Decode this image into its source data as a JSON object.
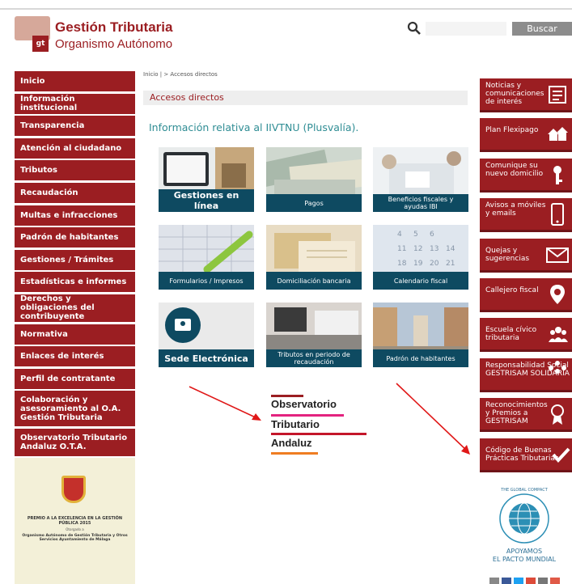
{
  "header": {
    "logo_title": "Gestión Tributaria",
    "logo_subtitle": "Organismo Autónomo",
    "logo_mark": "gt",
    "search_placeholder": "",
    "search_button": "Buscar"
  },
  "sidebar": {
    "items": [
      {
        "label": "Inicio"
      },
      {
        "label": "Información institucional"
      },
      {
        "label": "Transparencia"
      },
      {
        "label": "Atención al ciudadano"
      },
      {
        "label": "Tributos"
      },
      {
        "label": "Recaudación"
      },
      {
        "label": "Multas e infracciones"
      },
      {
        "label": "Padrón de habitantes"
      },
      {
        "label": "Gestiones / Trámites"
      },
      {
        "label": "Estadísticas e informes"
      },
      {
        "label": "Derechos y obligaciones del contribuyente"
      },
      {
        "label": "Normativa"
      },
      {
        "label": "Enlaces de interés"
      },
      {
        "label": "Perfil de contratante"
      },
      {
        "label": "Colaboración y asesoramiento al O.A. Gestión Tributaria"
      },
      {
        "label": "Observatorio Tributario Andaluz O.T.A."
      }
    ],
    "award": {
      "title": "PREMIO A LA EXCELENCIA EN LA GESTIÓN PÚBLICA 2015",
      "granted": "Otorgado a",
      "recipient": "Organismo Autónomo de Gestión Tributaria y Otros Servicios Ayuntamiento de Málaga"
    }
  },
  "main": {
    "breadcrumb": "Inicio | > Accesos directos",
    "section_title": "Accesos directos",
    "info_link": "Información relativa al IIVTNU (Plusvalía).",
    "tiles": [
      {
        "label": "Gestiones en línea"
      },
      {
        "label": "Pagos"
      },
      {
        "label": "Beneficios fiscales y ayudas IBI"
      },
      {
        "label": "Formularios / Impresos"
      },
      {
        "label": "Domiciliación bancaria"
      },
      {
        "label": "Calendario fiscal"
      },
      {
        "label": "Sede Electrónica"
      },
      {
        "label": "Tributos en periodo de recaudación"
      },
      {
        "label": "Padrón de habitantes"
      }
    ],
    "observatorio": [
      "Observatorio",
      "Tributario",
      "Andaluz"
    ]
  },
  "rightcol": {
    "items": [
      {
        "label": "Noticias y comunicaciones de interés",
        "icon": "newspaper-icon"
      },
      {
        "label": "Plan Flexipago",
        "icon": "houses-icon"
      },
      {
        "label": "Comunique su nuevo domicilio",
        "icon": "key-icon"
      },
      {
        "label": "Avisos a móviles y emails",
        "icon": "mobile-icon"
      },
      {
        "label": "Quejas y sugerencias",
        "icon": "envelope-icon"
      },
      {
        "label": "Callejero fiscal",
        "icon": "map-pin-icon"
      },
      {
        "label": "Escuela cívico tributaria",
        "icon": "people-icon"
      },
      {
        "label": "Responsabilidad Social GESTRISAM SOLIDARIA",
        "icon": "group-icon"
      },
      {
        "label": "Reconocimientos y Premios a GESTRISAM",
        "icon": "medal-icon"
      },
      {
        "label": "Código de Buenas Prácticas Tributarias",
        "icon": "check-icon"
      }
    ],
    "compact_title": "THE GLOBAL COMPACT",
    "compact_line1": "APOYAMOS",
    "compact_line2": "EL PACTO MUNDIAL"
  },
  "colors": {
    "brand": "#9b1e22",
    "tile_caption": "#0e4a61",
    "link": "#2f8d94"
  }
}
